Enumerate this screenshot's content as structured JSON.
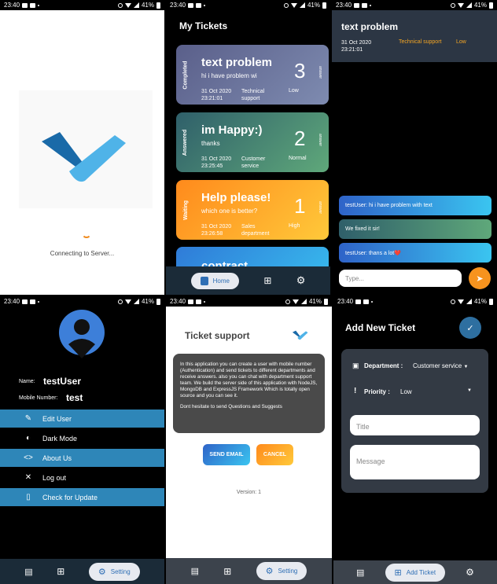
{
  "status_bar": {
    "time": "23:40",
    "battery": "41%"
  },
  "splash": {
    "status": "Connecting to Server..."
  },
  "tickets": {
    "title": "My Tickets",
    "answer_label": "answer",
    "cards": [
      {
        "status": "Completed",
        "title": "text problem",
        "subtitle": "hi i have problem wi",
        "count": "3",
        "date": "31 Oct 2020",
        "time": "23:21:01",
        "department": "Technical support",
        "priority": "Low",
        "gradient": [
          "#5a5f8a",
          "#7e8bb0"
        ]
      },
      {
        "status": "Answered",
        "title": "im Happy:)",
        "subtitle": "thanks",
        "count": "2",
        "date": "31 Oct 2020",
        "time": "23:25:45",
        "department": "Customer service",
        "priority": "Normal",
        "gradient": [
          "#2f5f6a",
          "#5fa87a"
        ]
      },
      {
        "status": "Waiting",
        "title": "Help please!",
        "subtitle": "which one is better?",
        "count": "1",
        "date": "31 Oct 2020",
        "time": "23:26:58",
        "department": "Sales department",
        "priority": "High",
        "gradient": [
          "#ff8a1c",
          "#ffc93a"
        ]
      },
      {
        "status": "",
        "title": "contract",
        "subtitle": "",
        "count": "",
        "date": "",
        "time": "",
        "department": "",
        "priority": "",
        "gradient": [
          "#2f7bd8",
          "#39c3f0"
        ]
      }
    ],
    "nav_home": "Home"
  },
  "chat": {
    "title": "text problem",
    "date": "31 Oct 2020",
    "time": "23:21:01",
    "department": "Technical support",
    "priority": "Low",
    "messages": [
      {
        "text": "testUser: hi i have problem with text"
      },
      {
        "text": "We fixed it sir!"
      },
      {
        "text": "testUser: thans a lot❤️"
      }
    ],
    "input_placeholder": "Type..."
  },
  "profile": {
    "name_label": "Name:",
    "name": "testUser",
    "mobile_label": "Mobile Number:",
    "mobile": "test",
    "menu": [
      {
        "label": "Edit User",
        "icon": "pencil-icon"
      },
      {
        "label": "Dark Mode",
        "icon": "contrast-icon"
      },
      {
        "label": "About Us",
        "icon": "code-icon"
      },
      {
        "label": "Log out",
        "icon": "close-icon"
      },
      {
        "label": "Check for Update",
        "icon": "phone-update-icon"
      }
    ],
    "nav_setting": "Setting"
  },
  "about": {
    "title": "Ticket support",
    "body": "In this application you can create a user with mobile number (Authentication) and send tickets to different departments and receive answers. also you can chat with department support team. We build the server side of this application with NodeJS, MongoDB and ExpressJS Framework Which is totally open source and you can see it.",
    "body2": "Dont hesitate to send Questions and Suggests",
    "send_email": "SEND EMAIL",
    "cancel": "CANCEL",
    "version": "Version: 1",
    "nav_setting": "Setting"
  },
  "new_ticket": {
    "title": "Add New Ticket",
    "department_label": "Department :",
    "department_value": "Customer service",
    "priority_label": "Priority :",
    "priority_value": "Low",
    "title_placeholder": "Title",
    "message_placeholder": "Message",
    "nav_add": "Add Ticket"
  }
}
